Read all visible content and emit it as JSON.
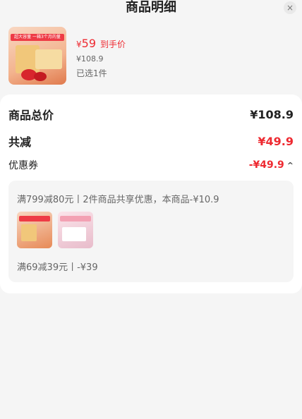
{
  "header": {
    "title": "商品明细",
    "close_glyph": "×"
  },
  "product": {
    "image_tag": "超大容量 一箱3个月的量",
    "price_symbol": "¥",
    "price": "59",
    "price_hint": "到手价",
    "original_price": "¥108.9",
    "selected": "已选1件"
  },
  "summary": {
    "total_label": "商品总价",
    "total_value": "¥108.9",
    "discount_label": "共减",
    "discount_value": "¥49.9",
    "coupon_label": "优惠券",
    "coupon_value": "-¥49.9",
    "coupon_chevron_glyph": "^"
  },
  "coupon_detail": {
    "rule1": "满799减80元丨2件商品共享优惠，本商品-¥10.9",
    "rule2": "满69减39元丨-¥39"
  },
  "colors": {
    "accent_red": "#ee2a31",
    "card_bg": "#ffffff",
    "page_bg": "#f5f5f5"
  }
}
